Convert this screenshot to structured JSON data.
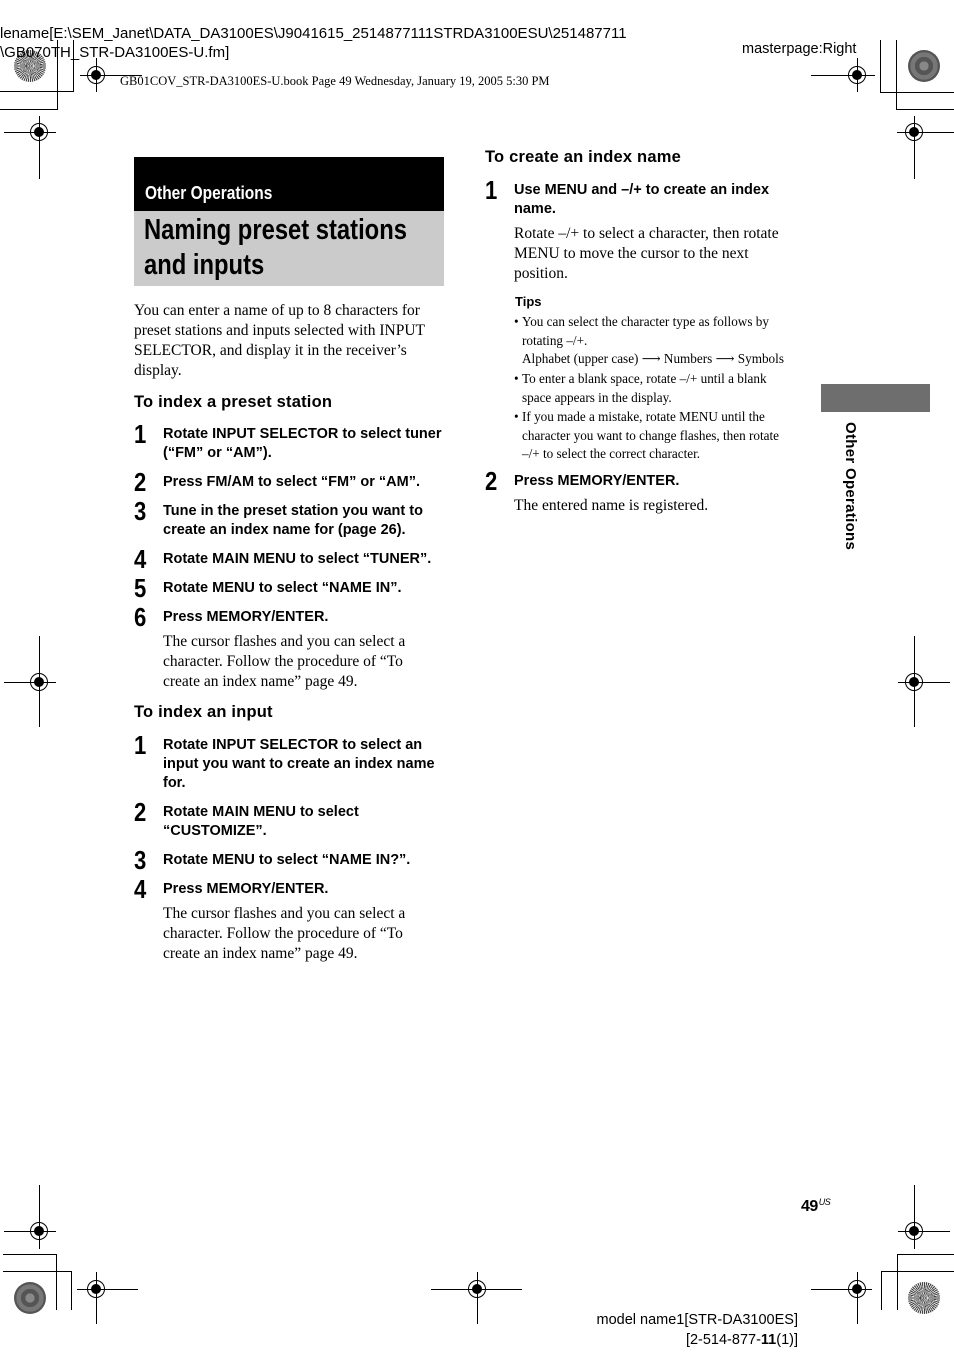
{
  "meta": {
    "filename_line1": "lename[E:\\SEM_Janet\\DATA_DA3100ES\\J9041615_2514877111STRDA3100ESU\\251487711",
    "filename_line2": "\\GB070TH_STR-DA3100ES-U.fm]",
    "book_line": "GB01COV_STR-DA3100ES-U.book  Page 49  Wednesday, January 19, 2005  5:30 PM",
    "masterpage": "masterpage:Right",
    "page_number": "49",
    "page_suffix": "US",
    "model_line1": "model name1[STR-DA3100ES]",
    "model_line2_a": "[2-514-877-",
    "model_line2_b": "11",
    "model_line2_c": "(1)]"
  },
  "section": {
    "category": "Other Operations",
    "title_line1": "Naming preset stations",
    "title_line2": "and inputs",
    "side_tab": "Other Operations"
  },
  "intro": "You can enter a name of up to 8 characters for preset stations and inputs selected with INPUT SELECTOR, and display it in the receiver’s display.",
  "preset_station": {
    "heading": "To index a preset station",
    "steps": [
      {
        "num": "1",
        "text": "Rotate INPUT SELECTOR to select tuner (“FM” or “AM”)."
      },
      {
        "num": "2",
        "text": "Press FM/AM to select “FM” or “AM”."
      },
      {
        "num": "3",
        "text": "Tune in the preset station you want to create an index name for (page 26)."
      },
      {
        "num": "4",
        "text": "Rotate MAIN MENU to select “TUNER”."
      },
      {
        "num": "5",
        "text": "Rotate MENU to select “NAME IN”."
      },
      {
        "num": "6",
        "text": "Press MEMORY/ENTER.",
        "desc": "The cursor flashes and you can select a character. Follow the procedure of “To create an index name” page 49."
      }
    ]
  },
  "input": {
    "heading": "To index an input",
    "steps": [
      {
        "num": "1",
        "text": "Rotate INPUT SELECTOR to select an input you want to create an index name for."
      },
      {
        "num": "2",
        "text": "Rotate MAIN MENU to select “CUSTOMIZE”."
      },
      {
        "num": "3",
        "text": "Rotate MENU to select “NAME IN?”."
      },
      {
        "num": "4",
        "text": "Press MEMORY/ENTER.",
        "desc": "The cursor flashes and you can select a character. Follow the procedure of “To create an index name” page 49."
      }
    ]
  },
  "index_name": {
    "heading": "To create an index name",
    "steps": [
      {
        "num": "1",
        "text": "Use MENU and –/+ to create an index name.",
        "desc": "Rotate –/+ to select a character, then rotate MENU to move the cursor to the next position."
      },
      {
        "num": "2",
        "text": "Press MEMORY/ENTER.",
        "desc": "The entered name is registered."
      }
    ],
    "tips_heading": "Tips",
    "tips": [
      {
        "lines": [
          "You can select the character type as follows by",
          "rotating –/+.",
          "Alphabet (upper case) ⟶ Numbers ⟶ Symbols"
        ]
      },
      {
        "lines": [
          "To enter a blank space, rotate –/+ until a blank",
          "space appears in the display."
        ]
      },
      {
        "lines": [
          "If you made a mistake, rotate MENU until the",
          "character you want to change flashes, then rotate",
          "–/+ to select the correct character."
        ]
      }
    ]
  }
}
